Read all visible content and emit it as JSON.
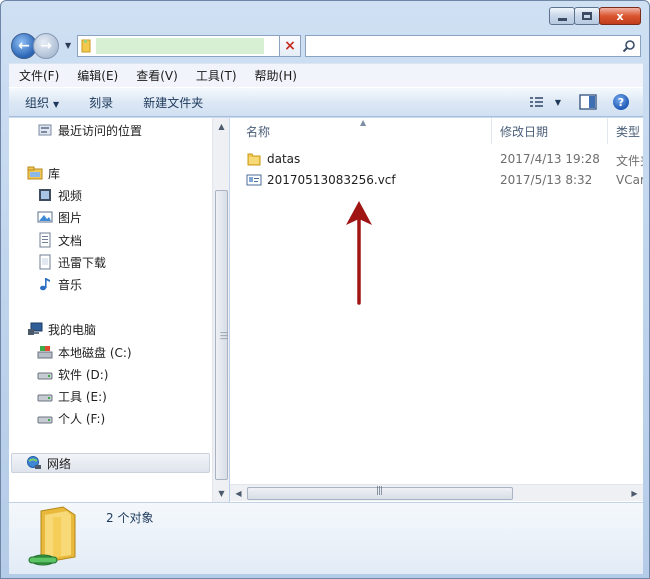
{
  "window": {
    "caption_buttons": {
      "minimize": "",
      "maximize": "",
      "close": "x"
    }
  },
  "address": {
    "path": "",
    "search_placeholder": ""
  },
  "menu": [
    {
      "label": "文件(F)"
    },
    {
      "label": "编辑(E)"
    },
    {
      "label": "查看(V)"
    },
    {
      "label": "工具(T)"
    },
    {
      "label": "帮助(H)"
    }
  ],
  "commands": {
    "organize": "组织",
    "burn": "刻录",
    "new_folder": "新建文件夹",
    "help_glyph": "?"
  },
  "sidebar": {
    "recent": "最近访问的位置",
    "libraries": "库",
    "library_items": [
      "视频",
      "图片",
      "文档",
      "迅雷下载",
      "音乐"
    ],
    "computer": "我的电脑",
    "drives": [
      "本地磁盘 (C:)",
      "软件 (D:)",
      "工具 (E:)",
      "个人 (F:)"
    ],
    "network": "网络"
  },
  "columns": {
    "name": "名称",
    "date": "修改日期",
    "type": "类型"
  },
  "files": [
    {
      "name": "datas",
      "date": "2017/4/13 19:28",
      "type": "文件夹",
      "icon": "folder-icon"
    },
    {
      "name": "20170513083256.vcf",
      "date": "2017/5/13 8:32",
      "type": "VCard",
      "icon": "vcard-file-icon"
    }
  ],
  "status": {
    "count": "2 个对象"
  },
  "colors": {
    "annotation_arrow": "#a01414",
    "window_chrome": "#bcd2ec",
    "folder": "#f2c94c"
  }
}
